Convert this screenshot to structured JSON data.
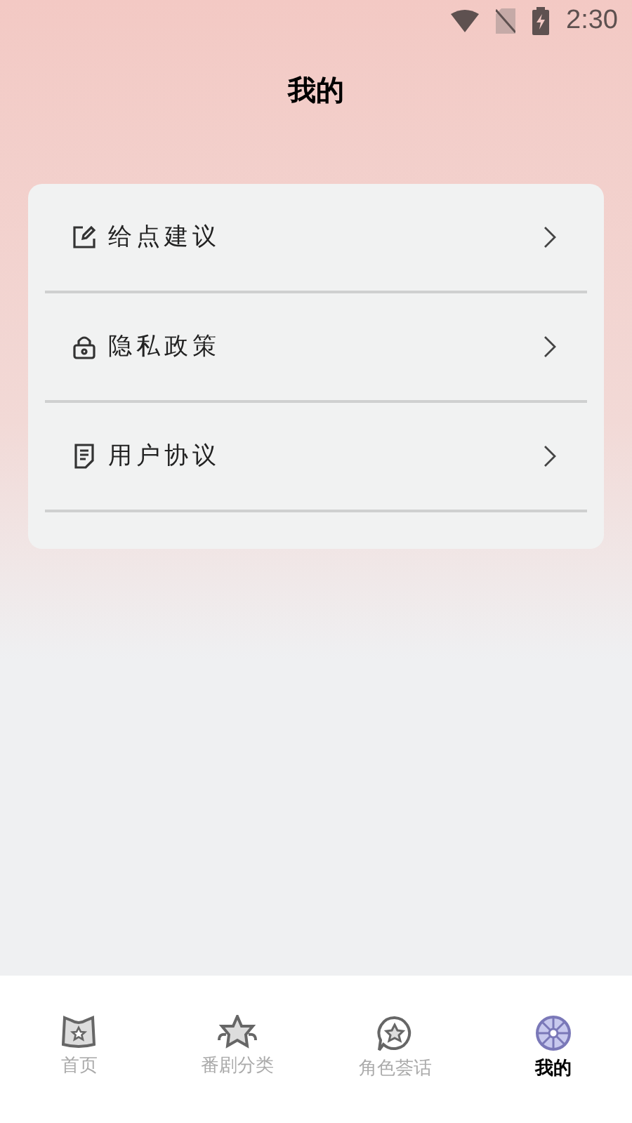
{
  "status_bar": {
    "time": "2:30"
  },
  "header": {
    "title": "我的"
  },
  "menu": [
    {
      "kind": "feedback",
      "label": "给点建议"
    },
    {
      "kind": "privacy",
      "label": "隐私政策"
    },
    {
      "kind": "agreement",
      "label": "用户协议"
    }
  ],
  "tabs": [
    {
      "kind": "home",
      "label": "首页",
      "selected": false
    },
    {
      "kind": "category",
      "label": "番剧分类",
      "selected": false
    },
    {
      "kind": "chat",
      "label": "角色荟话",
      "selected": false
    },
    {
      "kind": "mine",
      "label": "我的",
      "selected": true
    }
  ]
}
